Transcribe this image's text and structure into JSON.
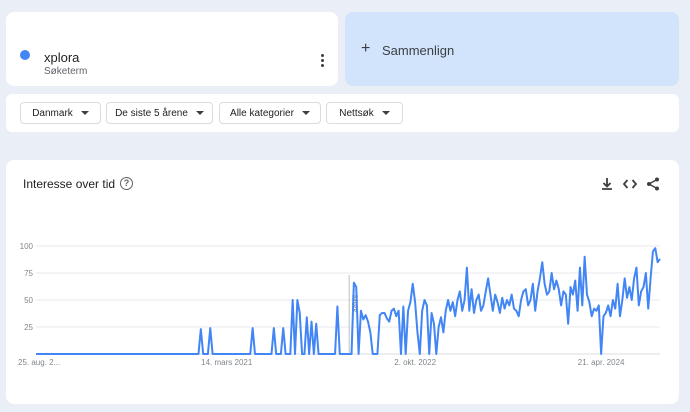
{
  "search_term": {
    "name": "xplora",
    "type": "Søketerm",
    "color": "#4285f4"
  },
  "compare": {
    "label": "Sammenlign"
  },
  "filters": [
    {
      "label": "Danmark"
    },
    {
      "label": "De siste 5 årene"
    },
    {
      "label": "Alle kategorier"
    },
    {
      "label": "Nettsøk"
    }
  ],
  "chart": {
    "title": "Interesse over tid",
    "note_label": "Merk"
  },
  "icons": [
    "help-icon",
    "download-icon",
    "embed-code-icon",
    "share-icon",
    "more-vert-icon",
    "plus-icon"
  ],
  "chart_data": {
    "type": "line",
    "title": "Interesse over tid",
    "xlabel": "",
    "ylabel": "",
    "ylim": [
      0,
      100
    ],
    "y_ticks": [
      25,
      50,
      75,
      100
    ],
    "x_tick_labels": [
      {
        "label": "25. aug. 2...",
        "index": 0
      },
      {
        "label": "14. mars 2021",
        "index": 81
      },
      {
        "label": "2. okt. 2022",
        "index": 161
      },
      {
        "label": "21. apr. 2024",
        "index": 240
      }
    ],
    "note_index": 133,
    "grid": true,
    "legend": "none",
    "series": [
      {
        "color": "#4285f4",
        "values": [
          0,
          0,
          0,
          0,
          0,
          0,
          0,
          0,
          0,
          0,
          0,
          0,
          0,
          0,
          0,
          0,
          0,
          0,
          0,
          0,
          0,
          0,
          0,
          0,
          0,
          0,
          0,
          0,
          0,
          0,
          0,
          0,
          0,
          0,
          0,
          0,
          0,
          0,
          0,
          0,
          0,
          0,
          0,
          0,
          0,
          0,
          0,
          0,
          0,
          0,
          0,
          0,
          0,
          0,
          0,
          0,
          0,
          0,
          0,
          0,
          0,
          0,
          0,
          0,
          0,
          0,
          0,
          0,
          0,
          0,
          23,
          0,
          0,
          0,
          24,
          0,
          0,
          0,
          0,
          0,
          0,
          0,
          0,
          0,
          0,
          0,
          0,
          0,
          0,
          0,
          0,
          0,
          24,
          0,
          0,
          0,
          0,
          0,
          0,
          0,
          0,
          24,
          0,
          0,
          0,
          24,
          0,
          0,
          0,
          50,
          0,
          50,
          38,
          0,
          0,
          34,
          0,
          30,
          0,
          28,
          0,
          0,
          0,
          0,
          0,
          0,
          0,
          0,
          44,
          0,
          0,
          0,
          0,
          0,
          0,
          66,
          62,
          0,
          40,
          32,
          36,
          30,
          20,
          0,
          0,
          0,
          36,
          38,
          38,
          33,
          30,
          40,
          42,
          35,
          40,
          0,
          44,
          0,
          40,
          48,
          65,
          48,
          20,
          0,
          40,
          50,
          45,
          0,
          38,
          28,
          0,
          25,
          34,
          20,
          40,
          50,
          40,
          48,
          35,
          50,
          58,
          40,
          50,
          80,
          40,
          60,
          38,
          50,
          55,
          40,
          45,
          58,
          70,
          55,
          40,
          55,
          48,
          38,
          52,
          42,
          50,
          45,
          55,
          42,
          40,
          35,
          50,
          58,
          60,
          45,
          50,
          65,
          40,
          58,
          70,
          85,
          65,
          55,
          58,
          75,
          60,
          68,
          60,
          45,
          58,
          55,
          28,
          62,
          55,
          68,
          40,
          80,
          45,
          90,
          55,
          48,
          35,
          42,
          40,
          45,
          0,
          35,
          38,
          45,
          35,
          50,
          42,
          65,
          35,
          50,
          70,
          52,
          62,
          50,
          70,
          80,
          45,
          58,
          62,
          75,
          42,
          70,
          95,
          98,
          85,
          88
        ]
      }
    ]
  }
}
